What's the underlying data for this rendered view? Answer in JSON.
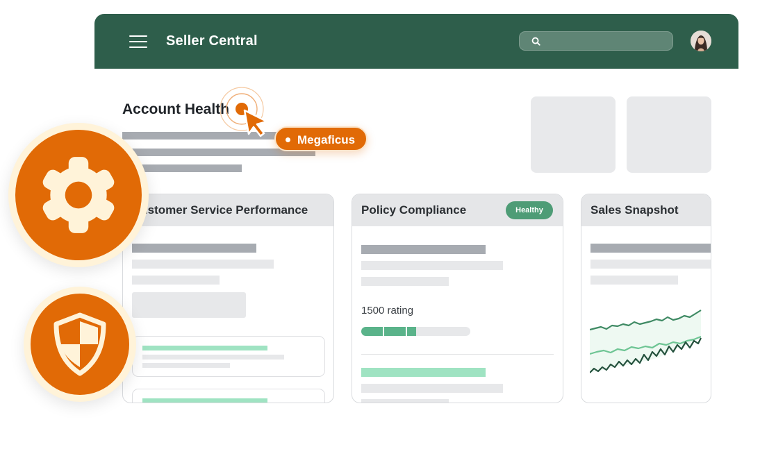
{
  "header": {
    "brand": "Seller Central",
    "search_placeholder": "",
    "icons": [
      "menu-icon",
      "search-icon",
      "avatar"
    ]
  },
  "main": {
    "title": "Account Health"
  },
  "cards": [
    {
      "title": "Customer Service Performance"
    },
    {
      "title": "Policy Compliance",
      "badge": "Healthy",
      "rating_label": "1500 rating",
      "rating_progress": 0.5
    },
    {
      "title": "Sales Snapshot"
    }
  ],
  "cursor": {
    "user_label": "Megaficus"
  },
  "feature_icons": [
    "gear-icon",
    "shield-icon"
  ],
  "colors": {
    "header_bg": "#2e5e4b",
    "accent_orange": "#e16a06",
    "badge_green": "#4e9c76",
    "feature_halo": "#fff3d9"
  }
}
